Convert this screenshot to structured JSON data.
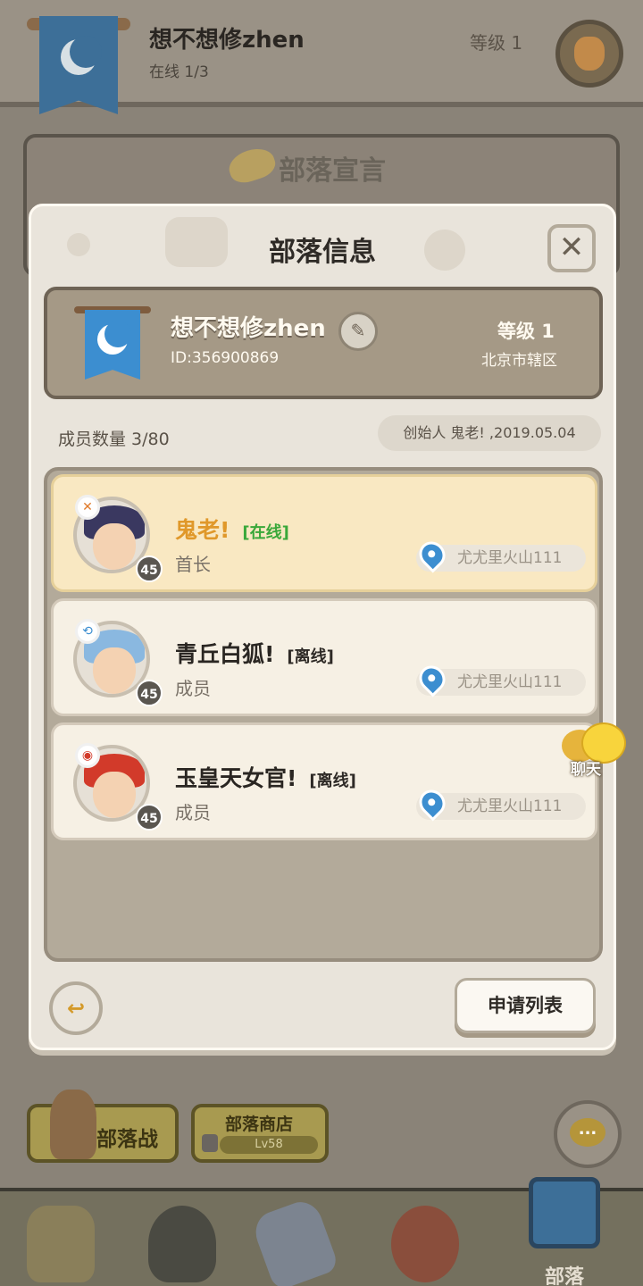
{
  "background": {
    "top_bar": {
      "tribe_name": "想不想修zhen",
      "online": "在线 1/3",
      "level": "等级 1"
    },
    "declaration_title": "部落宣言",
    "bottom_buttons": {
      "tribe_war": "部落战",
      "tribe_shop": "部落商店",
      "shop_lock_level": "Lv58",
      "chat_icon": "..."
    },
    "nav": {
      "active_label": "部落"
    }
  },
  "modal": {
    "title": "部落信息",
    "close": "✕",
    "tribe": {
      "name": "想不想修zhen",
      "id": "ID:356900869",
      "level": "等级 1",
      "region": "北京市辖区",
      "edit_icon": "✎"
    },
    "member_count": "成员数量 3/80",
    "founder": "创始人 鬼老! ,2019.05.04",
    "members": [
      {
        "name": "鬼老!",
        "status": "[在线]",
        "role": "首长",
        "level": "45",
        "location": "尤尤里火山111",
        "badge": "✕",
        "status_color": "#3aa83a",
        "name_color": "#e0982a"
      },
      {
        "name": "青丘白狐!",
        "status": "[离线]",
        "role": "成员",
        "level": "45",
        "location": "尤尤里火山111",
        "badge": "⟲",
        "status_color": "#2e2a26",
        "name_color": "#2a2622"
      },
      {
        "name": "玉皇天女官!",
        "status": "[离线]",
        "role": "成员",
        "level": "45",
        "location": "尤尤里火山111",
        "badge": "◉",
        "status_color": "#2e2a26",
        "name_color": "#2a2622"
      }
    ],
    "chat_float_label": "聊天",
    "back_icon": "↩",
    "apply_list": "申请列表"
  }
}
